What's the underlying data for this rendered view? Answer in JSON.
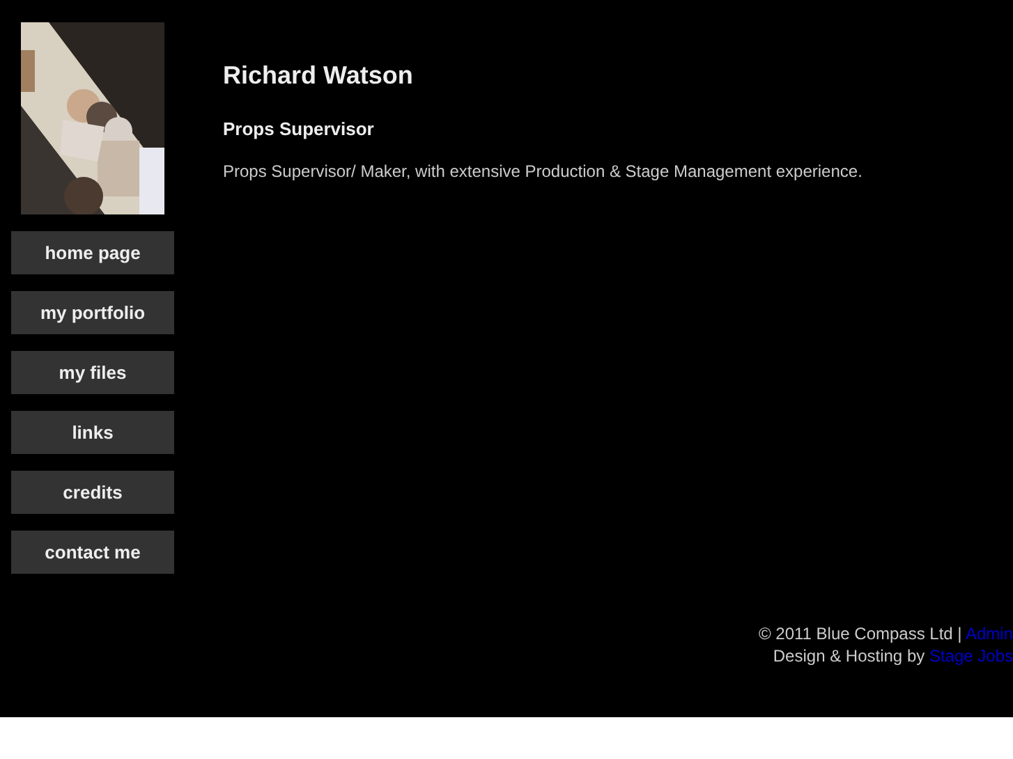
{
  "nav": [
    {
      "label": "home page"
    },
    {
      "label": "my portfolio"
    },
    {
      "label": "my files"
    },
    {
      "label": "links"
    },
    {
      "label": "credits"
    },
    {
      "label": "contact me"
    }
  ],
  "name": "Richard Watson",
  "role": "Props Supervisor",
  "bio": "Props Supervisor/ Maker, with extensive Production & Stage Management experience.",
  "footer": [
    {
      "text": "© 2011 Blue Compass Ltd | ",
      "link": "Admin"
    },
    {
      "text": "Design & Hosting by ",
      "link": "Stage Jobs"
    }
  ]
}
